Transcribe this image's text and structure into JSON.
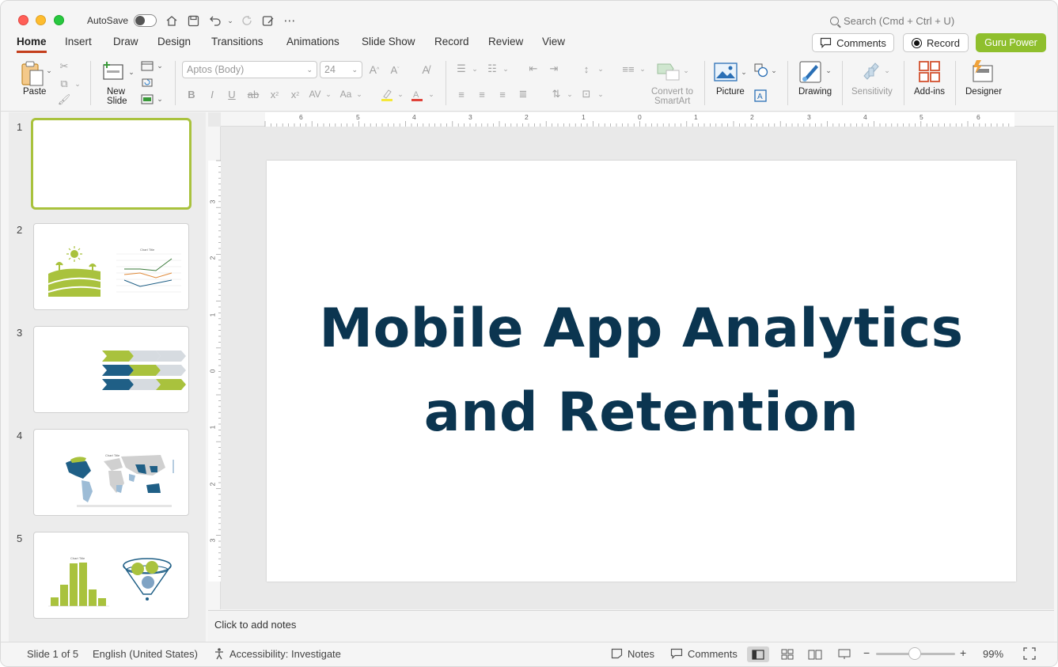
{
  "titlebar": {
    "autosave_label": "AutoSave",
    "search_placeholder": "Search (Cmd + Ctrl + U)"
  },
  "tabs": [
    {
      "label": "Home",
      "active": true
    },
    {
      "label": "Insert"
    },
    {
      "label": "Draw"
    },
    {
      "label": "Design"
    },
    {
      "label": "Transitions"
    },
    {
      "label": "Animations"
    },
    {
      "label": "Slide Show"
    },
    {
      "label": "Record"
    },
    {
      "label": "Review"
    },
    {
      "label": "View"
    }
  ],
  "header_buttons": {
    "comments": "Comments",
    "record": "Record",
    "guru": "Guru Power"
  },
  "ribbon": {
    "paste": "Paste",
    "new_slide_1": "New",
    "new_slide_2": "Slide",
    "font_name": "Aptos (Body)",
    "font_size": "24",
    "convert_1": "Convert to",
    "convert_2": "SmartArt",
    "picture": "Picture",
    "drawing": "Drawing",
    "sensitivity": "Sensitivity",
    "addins": "Add-ins",
    "designer": "Designer"
  },
  "slides": [
    {
      "number": "1"
    },
    {
      "number": "2",
      "chart_title": "Chart Title"
    },
    {
      "number": "3"
    },
    {
      "number": "4",
      "chart_title": "Chart Title"
    },
    {
      "number": "5",
      "chart_title": "Chart Title"
    }
  ],
  "ruler": {
    "h_ticks": [
      "6",
      "5",
      "4",
      "3",
      "2",
      "1",
      "0",
      "1",
      "2",
      "3",
      "4",
      "5",
      "6"
    ],
    "v_ticks": [
      "3",
      "2",
      "1",
      "0",
      "1",
      "2",
      "3"
    ]
  },
  "slide": {
    "title_line1": "Mobile App Analytics",
    "title_line2": "and Retention"
  },
  "notes": {
    "placeholder": "Click to add notes"
  },
  "statusbar": {
    "slide_info": "Slide 1 of 5",
    "language": "English (United States)",
    "accessibility": "Accessibility: Investigate",
    "notes": "Notes",
    "comments": "Comments",
    "zoom": "99%"
  },
  "colors": {
    "accent_red": "#c43e1c",
    "guru_green": "#8fbf2d",
    "title_navy": "#0b3550",
    "slide_green": "#a9c23d",
    "slide_blue": "#1f5f86"
  }
}
